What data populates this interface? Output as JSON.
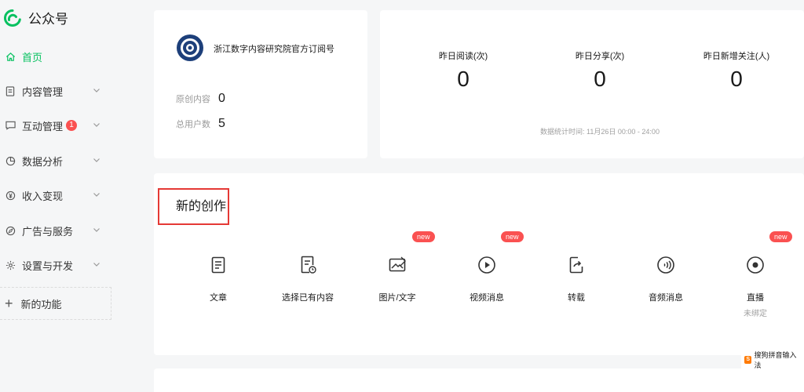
{
  "brand": {
    "name": "公众号",
    "accent": "#07c160"
  },
  "sidebar": {
    "items": [
      {
        "label": "首页",
        "icon": "home-icon"
      },
      {
        "label": "内容管理",
        "icon": "document-icon"
      },
      {
        "label": "互动管理",
        "icon": "chat-icon",
        "badge": "1"
      },
      {
        "label": "数据分析",
        "icon": "pie-chart-icon"
      },
      {
        "label": "收入变现",
        "icon": "yen-icon"
      },
      {
        "label": "广告与服务",
        "icon": "compass-icon"
      },
      {
        "label": "设置与开发",
        "icon": "gear-icon"
      }
    ],
    "new_function": "新的功能"
  },
  "account": {
    "name": "浙江数字内容研究院官方订阅号",
    "original_label": "原创内容",
    "original_value": "0",
    "users_label": "总用户数",
    "users_value": "5"
  },
  "stats": {
    "read_label": "昨日阅读(次)",
    "read_value": "0",
    "share_label": "昨日分享(次)",
    "share_value": "0",
    "follow_label": "昨日新增关注(人)",
    "follow_value": "0",
    "time_note": "数据统计时间: 11月26日 00:00 - 24:00"
  },
  "create": {
    "title": "新的创作",
    "new_tag": "new",
    "tools": [
      {
        "label": "文章",
        "icon": "article-icon"
      },
      {
        "label": "选择已有内容",
        "icon": "existing-content-icon"
      },
      {
        "label": "图片/文字",
        "icon": "image-text-icon"
      },
      {
        "label": "视频消息",
        "icon": "video-play-icon"
      },
      {
        "label": "转载",
        "icon": "repost-icon"
      },
      {
        "label": "音频消息",
        "icon": "audio-icon"
      },
      {
        "label": "直播",
        "icon": "live-icon",
        "sub": "未绑定"
      }
    ]
  },
  "ime": {
    "label": "搜狗拼音输入法"
  }
}
